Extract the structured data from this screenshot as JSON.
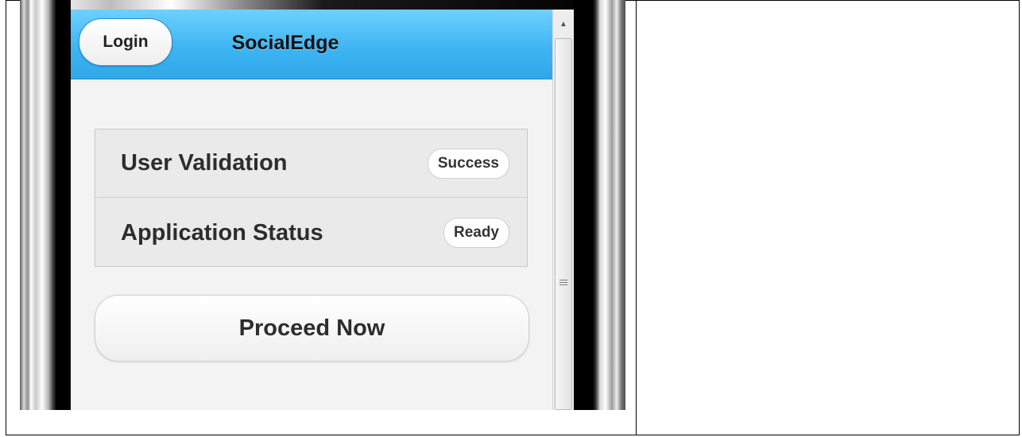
{
  "header": {
    "login_label": "Login",
    "title": "SocialEdge"
  },
  "status_list": [
    {
      "label": "User Validation",
      "badge": "Success"
    },
    {
      "label": "Application Status",
      "badge": "Ready"
    }
  ],
  "actions": {
    "proceed_label": "Proceed Now"
  },
  "icons": {
    "scroll_up": "scroll-up-arrow-icon",
    "scroll_grip": "scroll-grip-icon"
  },
  "colors": {
    "header_blue": "#3fb5f2",
    "badge_bg": "#ffffff",
    "text_dark": "#2d2d2d"
  }
}
